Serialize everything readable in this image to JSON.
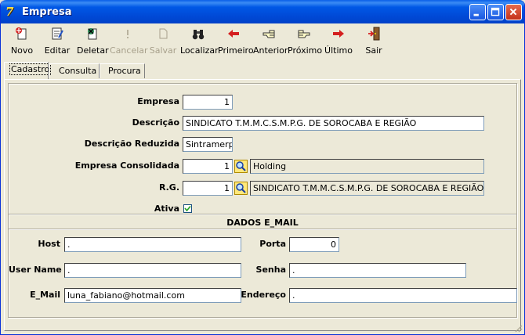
{
  "window": {
    "title": "Empresa",
    "icon": "app-logo-icon"
  },
  "toolbar": {
    "buttons": [
      {
        "label": "Novo",
        "icon": "new-icon",
        "enabled": true
      },
      {
        "label": "Editar",
        "icon": "edit-icon",
        "enabled": true
      },
      {
        "label": "Deletar",
        "icon": "delete-icon",
        "enabled": true
      },
      {
        "label": "Cancelar",
        "icon": "cancel-icon",
        "enabled": false
      },
      {
        "label": "Salvar",
        "icon": "save-icon",
        "enabled": false
      },
      {
        "label": "Localizar",
        "icon": "binoculars-icon",
        "enabled": true
      },
      {
        "label": "Primeiro",
        "icon": "first-arrow-icon",
        "enabled": true
      },
      {
        "label": "Anterior",
        "icon": "previous-hand-icon",
        "enabled": true
      },
      {
        "label": "Próximo",
        "icon": "next-hand-icon",
        "enabled": true
      },
      {
        "label": "Último",
        "icon": "last-arrow-icon",
        "enabled": true
      },
      {
        "label": "Sair",
        "icon": "exit-door-icon",
        "enabled": true
      }
    ]
  },
  "tabs": [
    {
      "label": "Cadastro",
      "active": true
    },
    {
      "label": "Consulta",
      "active": false
    },
    {
      "label": "Procura",
      "active": false
    }
  ],
  "form": {
    "empresa": {
      "label": "Empresa",
      "value": "1"
    },
    "descricao": {
      "label": "Descrição",
      "value": "SINDICATO T.M.M.C.S.M.P.G. DE SOROCABA E REGIÃO"
    },
    "descricao_reduzida": {
      "label": "Descrição Reduzida",
      "value": "Sintramerpro"
    },
    "empresa_consolidada": {
      "label": "Empresa Consolidada",
      "value": "1",
      "lookup": "Holding"
    },
    "rg": {
      "label": "R.G.",
      "value": "1",
      "lookup": "SINDICATO T.M.M.C.S.M.P.G. DE SOROCABA E REGIÃO"
    },
    "ativa": {
      "label": "Ativa",
      "checked": true
    }
  },
  "email": {
    "section_title": "DADOS E_MAIL",
    "host": {
      "label": "Host",
      "value": "."
    },
    "porta": {
      "label": "Porta",
      "value": "0"
    },
    "user_name": {
      "label": "User Name",
      "value": "."
    },
    "senha": {
      "label": "Senha",
      "value": "."
    },
    "e_mail": {
      "label": "E_Mail",
      "value": "luna_fabiano@hotmail.com"
    },
    "endereco": {
      "label": "Endereço",
      "value": "."
    }
  },
  "colors": {
    "titlebar": "#0058e6",
    "window_bg": "#ece9d8",
    "field_border": "#7f9db9"
  }
}
